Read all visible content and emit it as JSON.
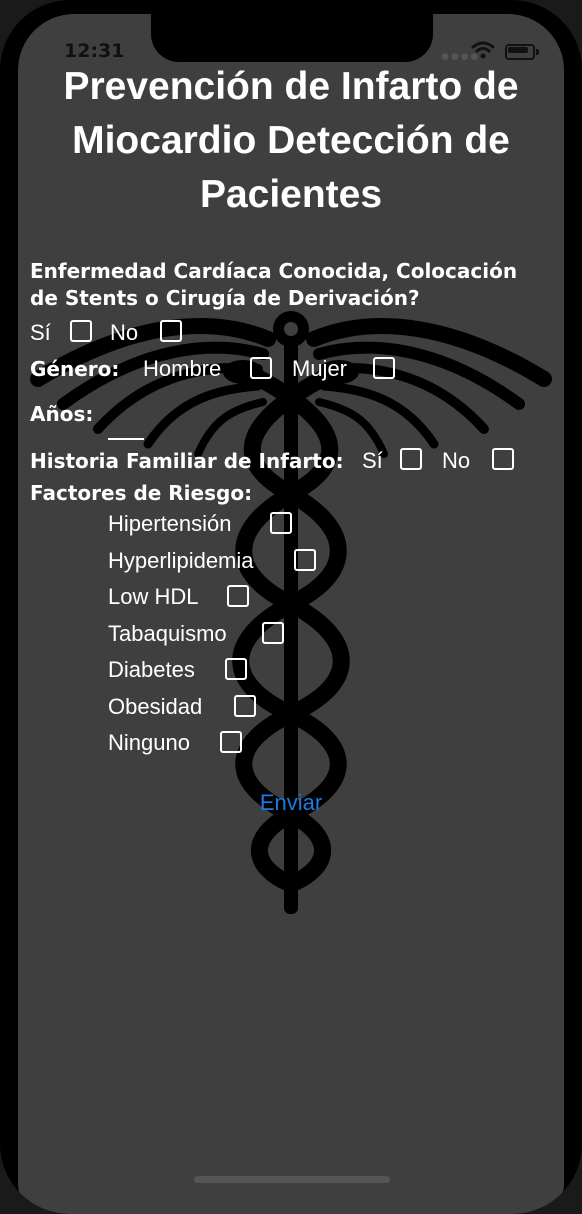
{
  "status_bar": {
    "time": "12:31"
  },
  "title": "Prevención de Infarto de Miocardio Detección de Pacientes",
  "question_heart": {
    "label": "Enfermedad Cardíaca Conocida, Colocación de Stents o Cirugía de Derivación?",
    "yes": "Sí",
    "no": "No"
  },
  "gender": {
    "label": "Género:",
    "male": "Hombre",
    "female": "Mujer"
  },
  "age": {
    "label": "Años:",
    "value": ""
  },
  "family_history": {
    "label": "Historia Familiar de Infarto:",
    "yes": "Sí",
    "no": "No"
  },
  "risk_factors": {
    "label": "Factores de Riesgo:",
    "items": [
      "Hipertensión",
      "Hyperlipidemia",
      "Low HDL",
      "Tabaquismo",
      "Diabetes",
      "Obesidad",
      "Ninguno"
    ]
  },
  "submit_label": "Enviar",
  "colors": {
    "background": "#3f3f3f",
    "link": "#1a7be0",
    "text": "#ffffff"
  }
}
